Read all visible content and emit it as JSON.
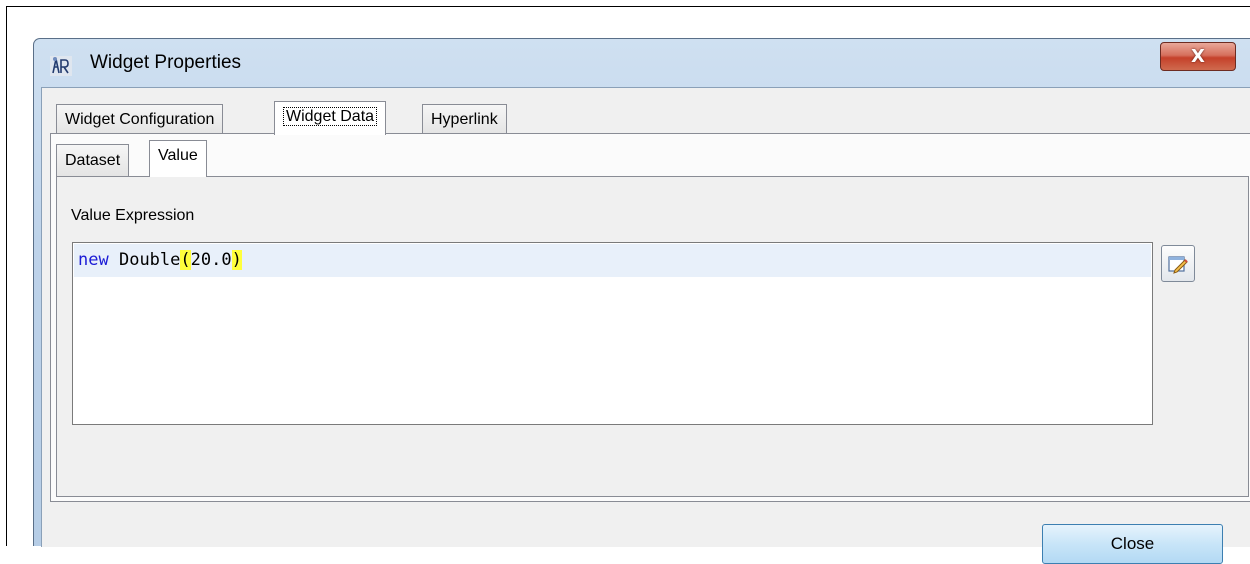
{
  "window": {
    "title": "Widget Properties",
    "close_glyph": "X",
    "app_icon": "report-designer-icon"
  },
  "tabs": [
    {
      "label": "Widget Configuration",
      "active": false
    },
    {
      "label": "Widget Data",
      "active": true
    },
    {
      "label": "Hyperlink",
      "active": false
    }
  ],
  "subtabs": [
    {
      "label": "Dataset",
      "active": false
    },
    {
      "label": "Value",
      "active": true
    }
  ],
  "value_panel": {
    "label": "Value Expression",
    "expression": {
      "keyword": "new",
      "class_name": "Double",
      "open_paren": "(",
      "argument": "20.0",
      "close_paren": ")"
    },
    "edit_icon": "edit-pencil-icon"
  },
  "footer": {
    "close_label": "Close"
  },
  "colors": {
    "keyword": "#1c1cd6",
    "paren_highlight": "#ffff3c",
    "current_line": "#e8f0fa"
  }
}
